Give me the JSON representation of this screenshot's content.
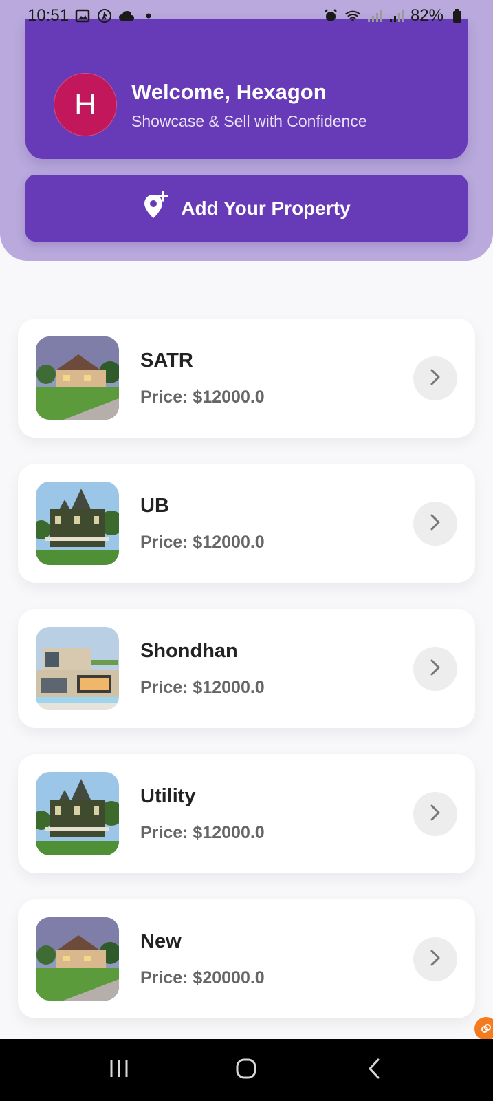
{
  "status_bar": {
    "time": "10:51",
    "battery": "82%"
  },
  "header": {
    "avatar_letter": "H",
    "welcome": "Welcome, Hexagon",
    "subtitle": "Showcase & Sell with Confidence"
  },
  "add_button": {
    "label": "Add Your Property"
  },
  "properties": [
    {
      "name": "SATR",
      "price": "Price: $12000.0",
      "image": "suburban-house"
    },
    {
      "name": "UB",
      "price": "Price: $12000.0",
      "image": "victorian-house"
    },
    {
      "name": "Shondhan",
      "price": "Price: $12000.0",
      "image": "modern-villa"
    },
    {
      "name": "Utility",
      "price": "Price: $12000.0",
      "image": "victorian-house"
    },
    {
      "name": "New",
      "price": "Price: $20000.0",
      "image": "suburban-house"
    }
  ],
  "colors": {
    "primary": "#673ab7",
    "avatar": "#c2185b",
    "background": "#f8f8fa",
    "panel": "#b9a9dc"
  },
  "icons": {
    "add_location": "add-location-icon",
    "chevron": "chevron-right-icon"
  }
}
